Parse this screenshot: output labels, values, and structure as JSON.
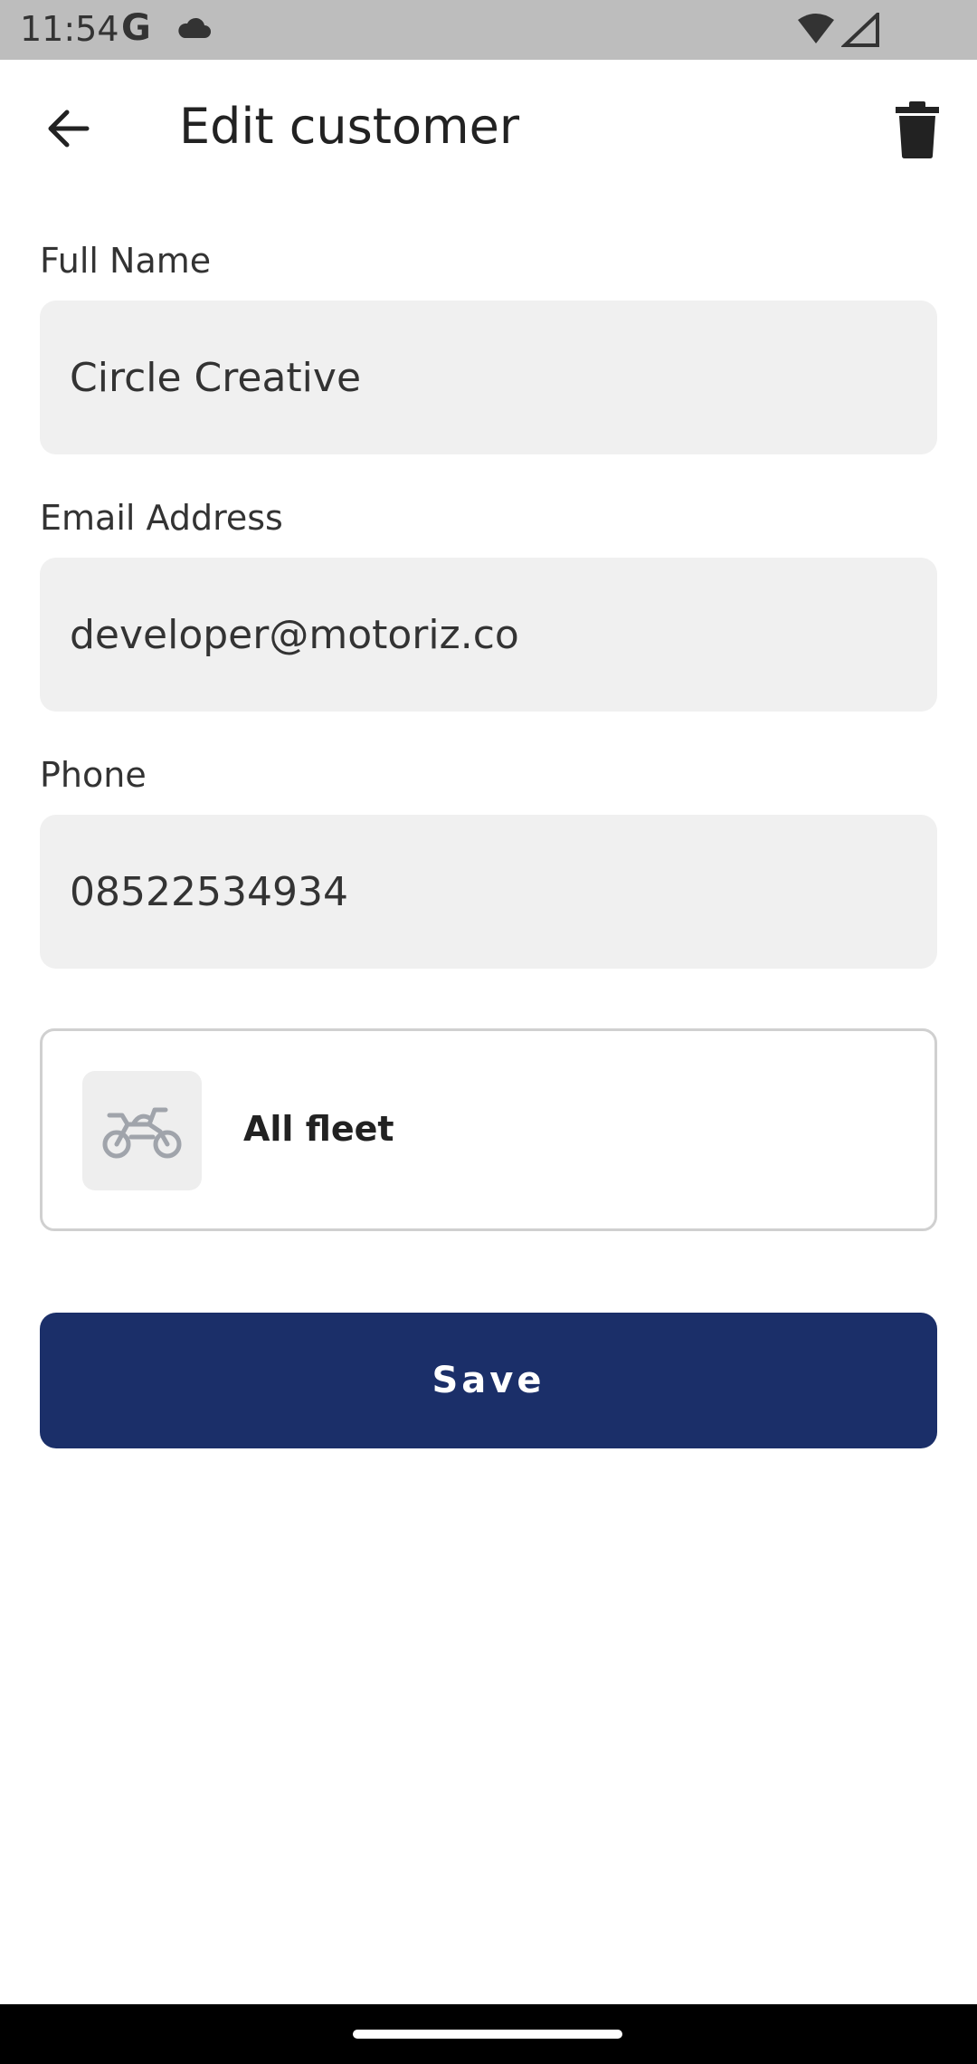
{
  "status_bar": {
    "time": "11:54",
    "google_glyph": "G",
    "icons": [
      "cloud-icon",
      "wifi-icon",
      "signal-icon"
    ]
  },
  "app_bar": {
    "title": "Edit customer",
    "back_icon": "arrow-left-icon",
    "delete_icon": "trash-icon"
  },
  "form": {
    "full_name": {
      "label": "Full Name",
      "value": "Circle Creative"
    },
    "email": {
      "label": "Email Address",
      "value": "developer@motoriz.co"
    },
    "phone": {
      "label": "Phone",
      "value": "08522534934"
    }
  },
  "fleet": {
    "label": "All fleet",
    "icon": "motorcycle-icon"
  },
  "save_button": {
    "label": "Save"
  },
  "colors": {
    "primary": "#1b2f69",
    "input_bg": "#f0f0f0",
    "status_bar": "#bdbdbd"
  }
}
